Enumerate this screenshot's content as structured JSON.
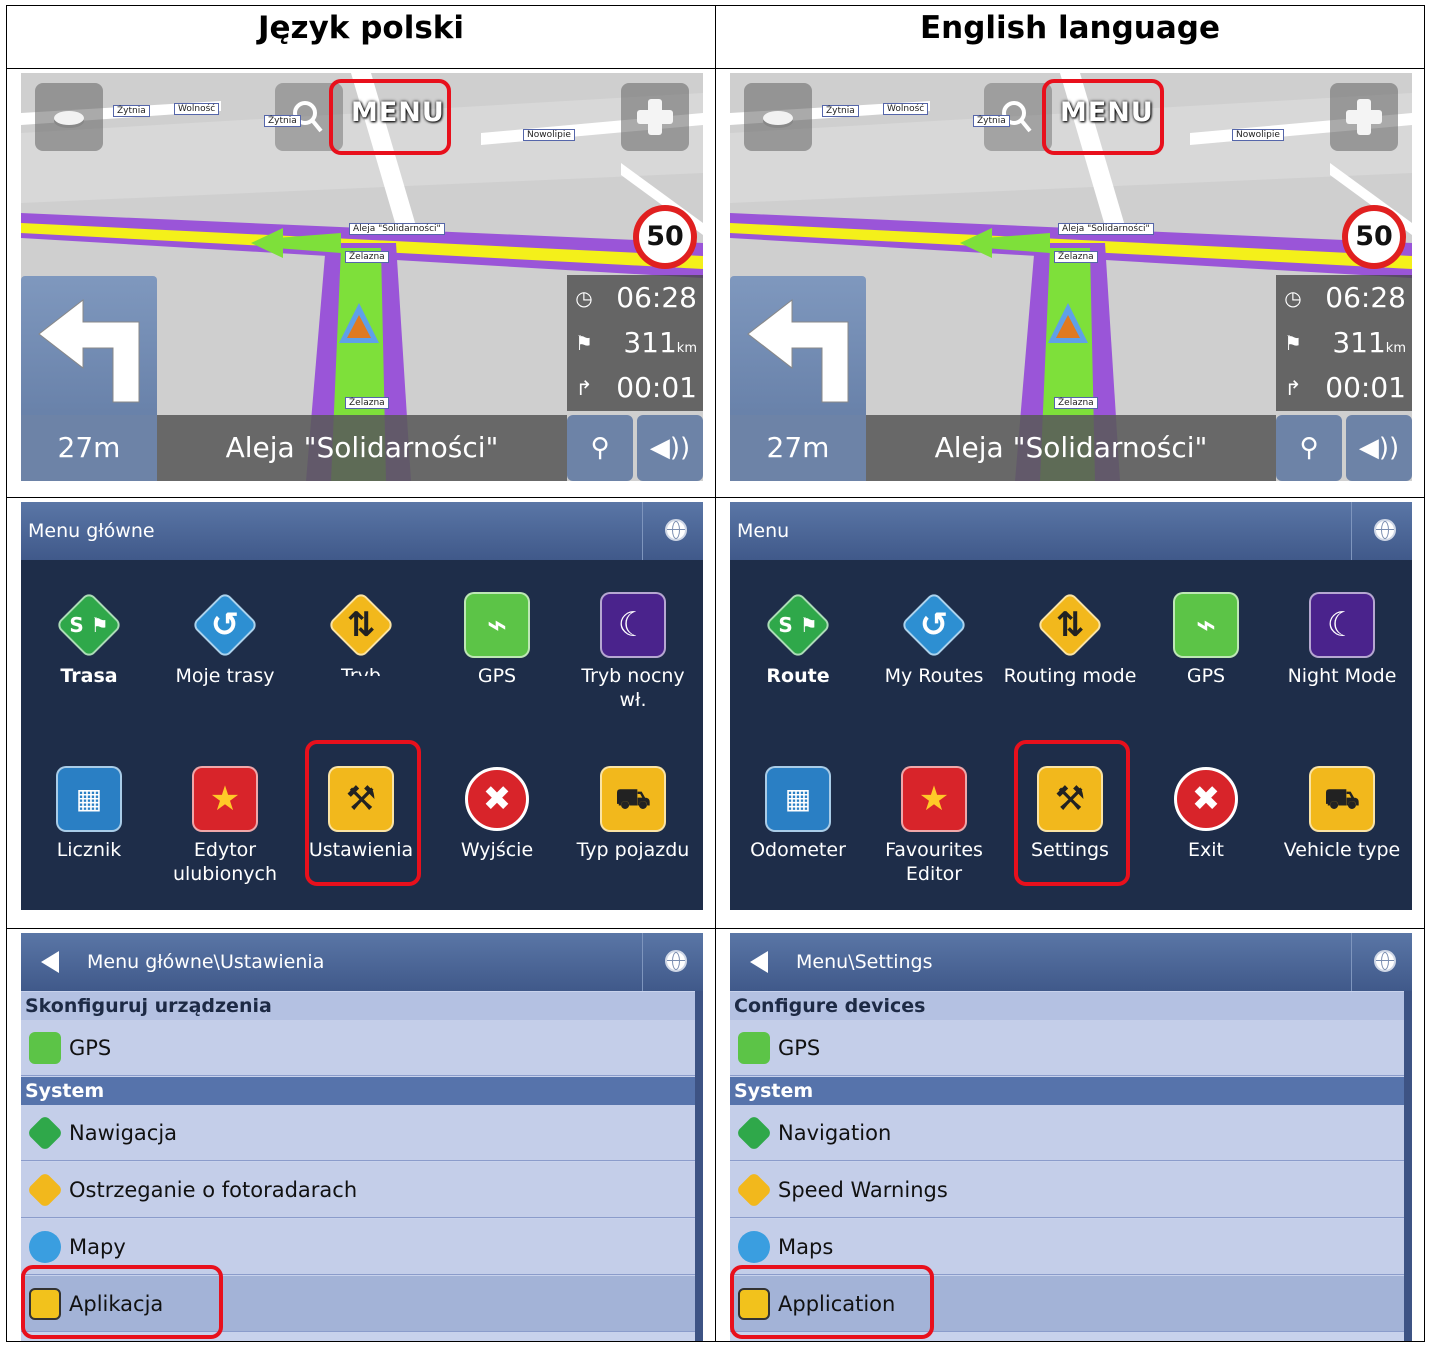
{
  "headers": {
    "polish": "Język polski",
    "english": "English language"
  },
  "map": {
    "menu_label": "MENU",
    "speed_limit": "50",
    "arrival_time": "06:28",
    "distance": "311",
    "distance_unit": "km",
    "time_remaining": "00:01",
    "turn_distance": "27m",
    "street_name": "Aleja \"Solidarności\"",
    "street_tags": [
      "Żytnia",
      "Wolność",
      "Żytnia",
      "Nowolipie",
      "Aleja \"Solidarności\"",
      "Żelazna",
      "Żelazna"
    ],
    "colors": {
      "route": "#8a3fd0",
      "road_yellow": "#f4f01a",
      "arrow": "#7ee03a",
      "panel": "#6d83a7",
      "highlight": "#e8101c"
    }
  },
  "menu_pl": {
    "title": "Menu główne",
    "items": [
      {
        "label": "Trasa",
        "icon": "route-icon"
      },
      {
        "label": "Moje trasy",
        "icon": "my-routes-icon"
      },
      {
        "label": "Tryb wyznaczania trasy",
        "icon": "routing-mode-icon"
      },
      {
        "label": "GPS",
        "icon": "gps-satellite-icon"
      },
      {
        "label": "Tryb nocny wł.",
        "icon": "night-mode-moon-icon"
      },
      {
        "label": "Licznik",
        "icon": "odometer-calculator-icon"
      },
      {
        "label": "Edytor ulubionych",
        "icon": "favourites-star-icon"
      },
      {
        "label": "Ustawienia",
        "icon": "settings-wrench-icon"
      },
      {
        "label": "Wyjście",
        "icon": "exit-x-icon"
      },
      {
        "label": "Typ pojazdu",
        "icon": "vehicle-type-icon"
      }
    ]
  },
  "menu_en": {
    "title": "Menu",
    "items": [
      {
        "label": "Route",
        "icon": "route-icon"
      },
      {
        "label": "My Routes",
        "icon": "my-routes-icon"
      },
      {
        "label": "Routing mode",
        "icon": "routing-mode-icon"
      },
      {
        "label": "GPS",
        "icon": "gps-satellite-icon"
      },
      {
        "label": "Night Mode",
        "icon": "night-mode-moon-icon"
      },
      {
        "label": "Odometer",
        "icon": "odometer-calculator-icon"
      },
      {
        "label": "Favourites Editor",
        "icon": "favourites-star-icon"
      },
      {
        "label": "Settings",
        "icon": "settings-wrench-icon"
      },
      {
        "label": "Exit",
        "icon": "exit-x-icon"
      },
      {
        "label": "Vehicle type",
        "icon": "vehicle-type-icon"
      }
    ]
  },
  "settings_pl": {
    "title": "Menu główne\\Ustawienia",
    "section1": "Skonfiguruj urządzenia",
    "gps": "GPS",
    "section2": "System",
    "navigation": "Nawigacja",
    "speed_warnings": "Ostrzeganie o fotoradarach",
    "maps": "Mapy",
    "application": "Aplikacja"
  },
  "settings_en": {
    "title": "Menu\\Settings",
    "section1": "Configure devices",
    "gps": "GPS",
    "section2": "System",
    "navigation": "Navigation",
    "speed_warnings": "Speed Warnings",
    "maps": "Maps",
    "application": "Application"
  }
}
